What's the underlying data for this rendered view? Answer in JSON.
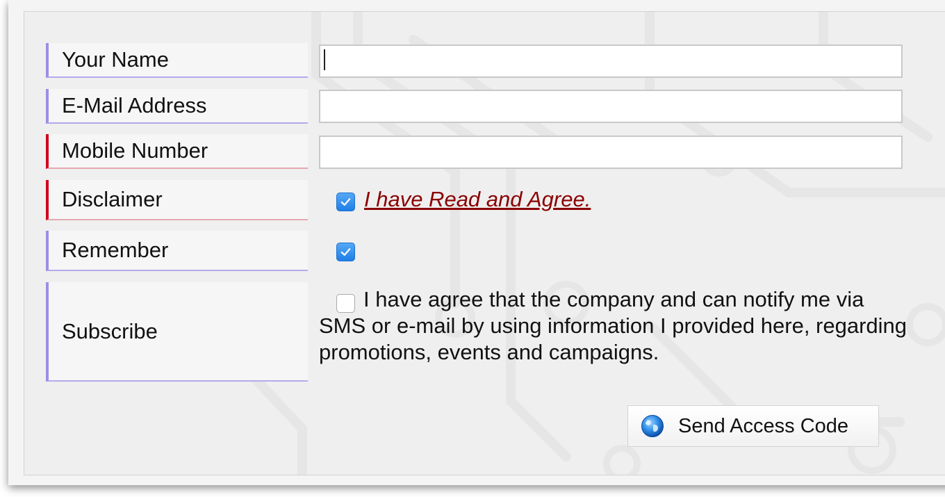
{
  "form": {
    "fields": [
      {
        "label": "Your Name",
        "required": false,
        "value": "",
        "placeholder": ""
      },
      {
        "label": "E-Mail Address",
        "required": false,
        "value": "",
        "placeholder": ""
      },
      {
        "label": "Mobile Number",
        "required": true,
        "value": "",
        "placeholder": ""
      }
    ],
    "disclaimer": {
      "label": "Disclaimer",
      "checked": true,
      "link_text": "I have Read and Agree."
    },
    "remember": {
      "label": "Remember",
      "checked": true
    },
    "subscribe": {
      "label": "Subscribe",
      "checked": false,
      "text": "I have agree that the company and can notify me via SMS or e-mail by using information I provided here, regarding promotions, events and campaigns."
    },
    "submit": {
      "label": "Send Access Code",
      "icon": "globe-icon"
    }
  },
  "colors": {
    "label_accent": "#9b8fe3",
    "required_accent": "#d3001b",
    "link": "#8b0000",
    "checkbox_checked": "#1f7fe6"
  }
}
